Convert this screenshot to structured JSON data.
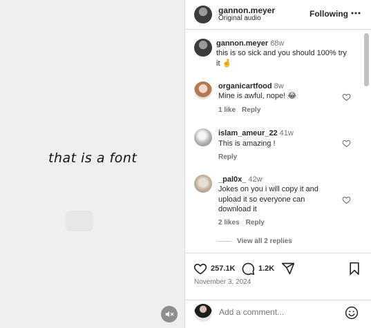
{
  "video": {
    "overlay_text": "that is a font",
    "mute_icon": "speaker-muted-icon"
  },
  "header": {
    "username": "gannon.meyer",
    "audio": "Original audio",
    "following_label": "Following",
    "more_icon": "more-horizontal-icon"
  },
  "caption": {
    "username": "gannon.meyer",
    "time": "68w",
    "text": "this is so sick and you should 100% try it 🤞"
  },
  "comments": [
    {
      "username": "organicartfood",
      "time": "8w",
      "text": "Mine is awful, nope! 😂",
      "likes": "1 like",
      "reply_label": "Reply"
    },
    {
      "username": "islam_ameur_22",
      "time": "41w",
      "text": "This is amazing !",
      "likes": "",
      "reply_label": "Reply"
    },
    {
      "username": "_pal0x_",
      "time": "42w",
      "text": "Jokes on you i will copy it and upload it so everyone can download it",
      "likes": "2 likes",
      "reply_label": "Reply"
    }
  ],
  "view_replies": "View all 2 replies",
  "actions": {
    "likes_count": "257.1K",
    "comments_count": "1.2K",
    "date": "November 3, 2024"
  },
  "add_comment": {
    "placeholder": "Add a comment..."
  },
  "colors": {
    "text": "#262626",
    "secondary": "#737373",
    "border": "#dbdbdb",
    "video_bg": "#efefef"
  }
}
